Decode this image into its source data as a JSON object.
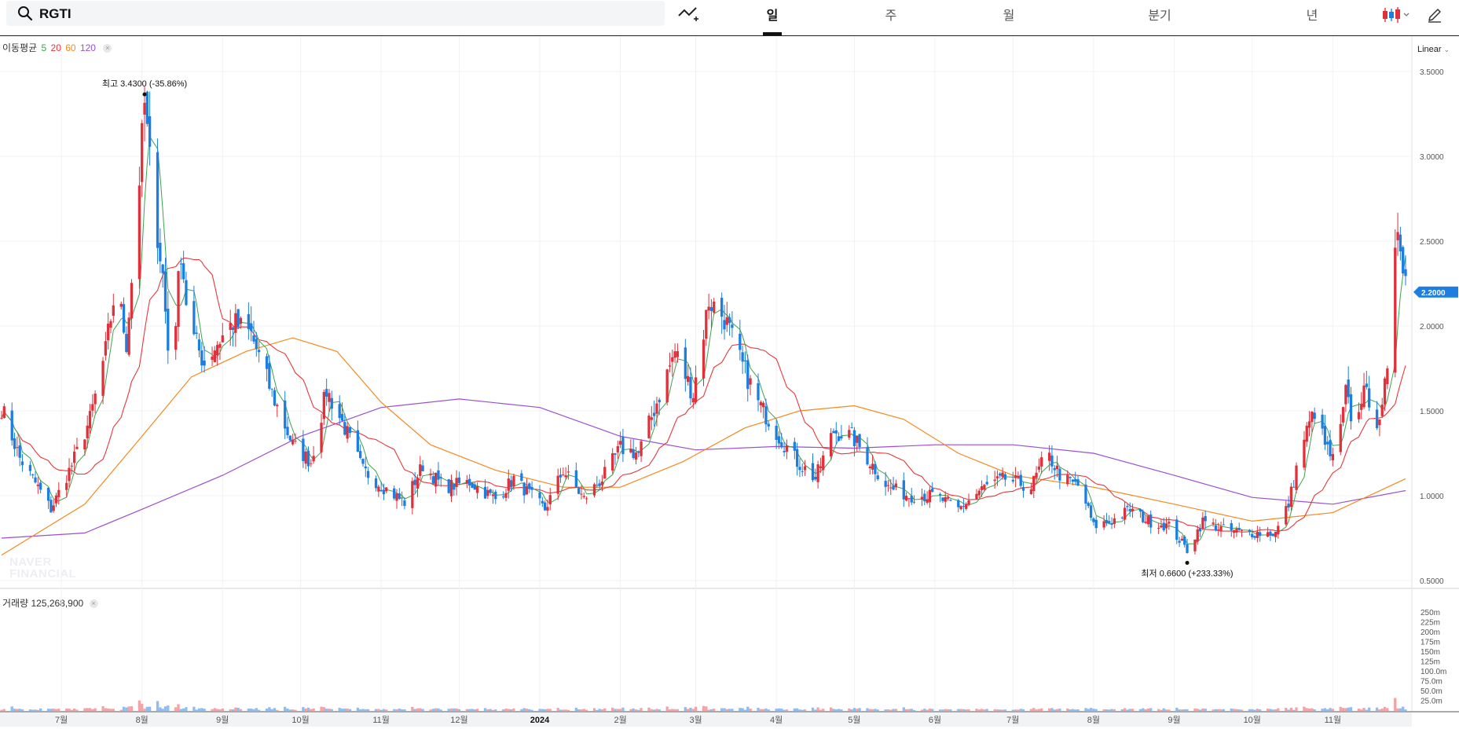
{
  "search": {
    "value": "RGTI"
  },
  "tabs": [
    {
      "label": "일",
      "active": true
    },
    {
      "label": "주",
      "active": false
    },
    {
      "label": "월",
      "active": false
    },
    {
      "label": "분기",
      "active": false
    },
    {
      "label": "년",
      "active": false
    }
  ],
  "icons": {
    "search": "search-icon",
    "draw": "indicator-draw-icon",
    "candle": "candle-type-icon",
    "pencil": "pencil-icon"
  },
  "scale_label": "Linear",
  "ma_legend": {
    "title": "이동평균",
    "periods": [
      "5",
      "20",
      "60",
      "120"
    ]
  },
  "volume_legend": {
    "label": "거래량",
    "value": "125,268,900"
  },
  "watermark": [
    "NAVER",
    "FINANCIAL"
  ],
  "colors": {
    "up": "#e0313b",
    "down": "#1c7ee0",
    "ma5": "#3fa34d",
    "ma20": "#e8373b",
    "ma60": "#f5891f",
    "ma120": "#9b4fd1",
    "current_price_bg": "#1c7ee0"
  },
  "chart_data": {
    "type": "candlestick",
    "price_axis": {
      "min": 0.5,
      "max": 3.5,
      "ticks": [
        "3.5000",
        "3.0000",
        "2.5000",
        "2.0000",
        "1.5000",
        "1.0000",
        "0.5000"
      ]
    },
    "volume_axis": {
      "min": 0,
      "max": 250,
      "ticks": [
        "250m",
        "225m",
        "200m",
        "175m",
        "150m",
        "125m",
        "100.0m",
        "75.0m",
        "50.0m",
        "25.0m"
      ]
    },
    "x_axis": {
      "labels": [
        "7월",
        "8월",
        "9월",
        "10월",
        "11월",
        "12월",
        "2024",
        "2월",
        "3월",
        "4월",
        "5월",
        "6월",
        "7월",
        "8월",
        "9월",
        "10월",
        "11월"
      ],
      "start": "2023-06-08",
      "end": "2024-11-29"
    },
    "high_marker": {
      "label": "최고",
      "value": "3.4300",
      "change": "(-35.86%)",
      "date": "2023-08-02"
    },
    "low_marker": {
      "label": "최저",
      "value": "0.6600",
      "change": "(+233.33%)",
      "date": "2024-09-06"
    },
    "current_price": "2.2000",
    "price_path": [
      [
        "2023-06-08",
        1.52
      ],
      [
        "2023-06-15",
        1.22
      ],
      [
        "2023-06-22",
        1.05
      ],
      [
        "2023-06-27",
        0.92
      ],
      [
        "2023-07-05",
        1.18
      ],
      [
        "2023-07-12",
        1.45
      ],
      [
        "2023-07-18",
        1.85
      ],
      [
        "2023-07-22",
        2.25
      ],
      [
        "2023-07-26",
        1.9
      ],
      [
        "2023-07-29",
        2.45
      ],
      [
        "2023-08-02",
        3.3
      ],
      [
        "2023-08-05",
        2.8
      ],
      [
        "2023-08-09",
        2.3
      ],
      [
        "2023-08-12",
        1.65
      ],
      [
        "2023-08-16",
        2.45
      ],
      [
        "2023-08-19",
        2.0
      ],
      [
        "2023-08-25",
        1.78
      ],
      [
        "2023-08-30",
        1.9
      ],
      [
        "2023-09-05",
        2.02
      ],
      [
        "2023-09-12",
        1.95
      ],
      [
        "2023-09-20",
        1.6
      ],
      [
        "2023-09-28",
        1.3
      ],
      [
        "2023-10-05",
        1.2
      ],
      [
        "2023-10-11",
        1.62
      ],
      [
        "2023-10-18",
        1.4
      ],
      [
        "2023-10-25",
        1.15
      ],
      [
        "2023-11-02",
        1.05
      ],
      [
        "2023-11-10",
        0.96
      ],
      [
        "2023-11-17",
        1.18
      ],
      [
        "2023-11-25",
        1.05
      ],
      [
        "2023-12-05",
        1.08
      ],
      [
        "2023-12-15",
        0.98
      ],
      [
        "2023-12-22",
        1.1
      ],
      [
        "2024-01-03",
        0.92
      ],
      [
        "2024-01-10",
        1.15
      ],
      [
        "2024-01-18",
        0.98
      ],
      [
        "2024-01-25",
        1.1
      ],
      [
        "2024-02-01",
        1.28
      ],
      [
        "2024-02-08",
        1.25
      ],
      [
        "2024-02-15",
        1.55
      ],
      [
        "2024-02-22",
        1.85
      ],
      [
        "2024-02-29",
        1.6
      ],
      [
        "2024-03-06",
        2.15
      ],
      [
        "2024-03-12",
        2.05
      ],
      [
        "2024-03-18",
        1.8
      ],
      [
        "2024-03-25",
        1.55
      ],
      [
        "2024-04-02",
        1.35
      ],
      [
        "2024-04-09",
        1.2
      ],
      [
        "2024-04-16",
        1.1
      ],
      [
        "2024-04-23",
        1.38
      ],
      [
        "2024-04-30",
        1.35
      ],
      [
        "2024-05-07",
        1.2
      ],
      [
        "2024-05-14",
        1.05
      ],
      [
        "2024-05-22",
        1.0
      ],
      [
        "2024-06-01",
        1.0
      ],
      [
        "2024-06-10",
        0.92
      ],
      [
        "2024-06-20",
        1.05
      ],
      [
        "2024-06-28",
        1.1
      ],
      [
        "2024-07-08",
        1.05
      ],
      [
        "2024-07-14",
        1.25
      ],
      [
        "2024-07-20",
        1.1
      ],
      [
        "2024-07-27",
        1.05
      ],
      [
        "2024-08-01",
        0.82
      ],
      [
        "2024-08-08",
        0.85
      ],
      [
        "2024-08-15",
        0.92
      ],
      [
        "2024-08-22",
        0.85
      ],
      [
        "2024-08-30",
        0.82
      ],
      [
        "2024-09-06",
        0.68
      ],
      [
        "2024-09-12",
        0.85
      ],
      [
        "2024-09-20",
        0.8
      ],
      [
        "2024-09-28",
        0.78
      ],
      [
        "2024-10-05",
        0.78
      ],
      [
        "2024-10-10",
        0.78
      ],
      [
        "2024-10-15",
        0.95
      ],
      [
        "2024-10-20",
        1.3
      ],
      [
        "2024-10-25",
        1.5
      ],
      [
        "2024-10-29",
        1.3
      ],
      [
        "2024-11-02",
        1.18
      ],
      [
        "2024-11-06",
        1.6
      ],
      [
        "2024-11-10",
        1.35
      ],
      [
        "2024-11-13",
        1.7
      ],
      [
        "2024-11-16",
        1.35
      ],
      [
        "2024-11-19",
        1.5
      ],
      [
        "2024-11-22",
        1.7
      ],
      [
        "2024-11-26",
        2.6
      ],
      [
        "2024-11-29",
        2.3
      ]
    ],
    "ma120_path": [
      [
        "2023-06-08",
        0.75
      ],
      [
        "2023-07-10",
        0.78
      ],
      [
        "2023-08-01",
        0.92
      ],
      [
        "2023-09-01",
        1.12
      ],
      [
        "2023-10-01",
        1.35
      ],
      [
        "2023-11-01",
        1.52
      ],
      [
        "2023-12-01",
        1.57
      ],
      [
        "2024-01-01",
        1.52
      ],
      [
        "2024-02-01",
        1.35
      ],
      [
        "2024-03-01",
        1.27
      ],
      [
        "2024-04-01",
        1.29
      ],
      [
        "2024-05-01",
        1.28
      ],
      [
        "2024-06-01",
        1.3
      ],
      [
        "2024-07-01",
        1.3
      ],
      [
        "2024-08-01",
        1.25
      ],
      [
        "2024-09-01",
        1.12
      ],
      [
        "2024-10-01",
        0.99
      ],
      [
        "2024-11-01",
        0.95
      ],
      [
        "2024-11-29",
        1.03
      ]
    ],
    "ma60_path": [
      [
        "2023-06-08",
        0.65
      ],
      [
        "2023-07-10",
        0.95
      ],
      [
        "2023-08-01",
        1.35
      ],
      [
        "2023-08-20",
        1.7
      ],
      [
        "2023-09-10",
        1.85
      ],
      [
        "2023-09-28",
        1.93
      ],
      [
        "2023-10-15",
        1.85
      ],
      [
        "2023-11-01",
        1.55
      ],
      [
        "2023-11-20",
        1.3
      ],
      [
        "2023-12-15",
        1.15
      ],
      [
        "2024-01-10",
        1.05
      ],
      [
        "2024-02-01",
        1.05
      ],
      [
        "2024-02-25",
        1.2
      ],
      [
        "2024-03-20",
        1.4
      ],
      [
        "2024-04-10",
        1.5
      ],
      [
        "2024-05-01",
        1.53
      ],
      [
        "2024-05-20",
        1.45
      ],
      [
        "2024-06-10",
        1.25
      ],
      [
        "2024-07-01",
        1.12
      ],
      [
        "2024-08-01",
        1.05
      ],
      [
        "2024-09-01",
        0.95
      ],
      [
        "2024-10-01",
        0.85
      ],
      [
        "2024-11-01",
        0.9
      ],
      [
        "2024-11-29",
        1.1
      ]
    ]
  }
}
